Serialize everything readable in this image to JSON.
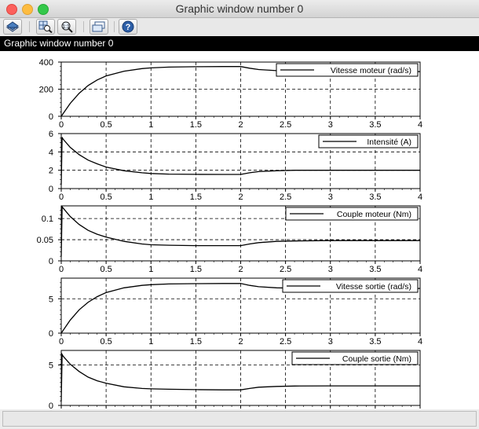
{
  "window": {
    "title": "Graphic window number 0"
  },
  "toolbar": {
    "buttons": [
      {
        "name": "rotate-icon"
      },
      {
        "name": "zoom-icon"
      },
      {
        "name": "unzoom-icon"
      },
      {
        "name": "datatip-icon"
      },
      {
        "name": "help-icon"
      }
    ]
  },
  "header": {
    "label": "Graphic window number 0"
  },
  "chart_data": [
    {
      "type": "line",
      "legend": "Vitesse moteur (rad/s)",
      "legend_position": "top-right",
      "xlim": [
        0,
        4
      ],
      "ylim": [
        0,
        400
      ],
      "xticks": [
        "0",
        "0.5",
        "1",
        "1.5",
        "2",
        "2.5",
        "3",
        "3.5",
        "4"
      ],
      "yticks": [
        0,
        200,
        400
      ],
      "grid": true,
      "x": [
        0,
        0.1,
        0.2,
        0.3,
        0.4,
        0.5,
        0.7,
        0.9,
        1.0,
        1.2,
        1.5,
        1.8,
        2.0,
        2.1,
        2.2,
        2.4,
        2.6,
        3.0,
        3.5,
        4.0
      ],
      "y": [
        0,
        95,
        170,
        227,
        268,
        298,
        333,
        352,
        357,
        363,
        366,
        367,
        367,
        355,
        345,
        337,
        333,
        330,
        330,
        330
      ]
    },
    {
      "type": "line",
      "legend": "Intensité (A)",
      "legend_position": "top-right",
      "xlim": [
        0,
        4
      ],
      "ylim": [
        0,
        6
      ],
      "xticks": [
        "0",
        "0.5",
        "1",
        "1.5",
        "2",
        "2.5",
        "3",
        "3.5",
        "4"
      ],
      "yticks": [
        0,
        2,
        4,
        6
      ],
      "grid": true,
      "x": [
        0,
        0.01,
        0.02,
        0.1,
        0.2,
        0.3,
        0.4,
        0.5,
        0.7,
        0.9,
        1.0,
        1.2,
        1.5,
        1.8,
        2.0,
        2.1,
        2.2,
        2.4,
        2.6,
        3.0,
        3.5,
        4.0
      ],
      "y": [
        0.4,
        5.6,
        5.4,
        4.5,
        3.7,
        3.1,
        2.7,
        2.35,
        1.95,
        1.72,
        1.65,
        1.58,
        1.55,
        1.54,
        1.54,
        1.72,
        1.85,
        1.95,
        2.0,
        2.0,
        2.0,
        2.0
      ]
    },
    {
      "type": "line",
      "legend": "Couple moteur (Nm)",
      "legend_position": "top-right",
      "xlim": [
        0,
        4
      ],
      "ylim": [
        0,
        0.13
      ],
      "xticks": [
        "0",
        "0.5",
        "1",
        "1.5",
        "2",
        "2.5",
        "3",
        "3.5",
        "4"
      ],
      "yticks": [
        0,
        0.05,
        0.1
      ],
      "grid": true,
      "x": [
        0,
        0.01,
        0.02,
        0.1,
        0.2,
        0.3,
        0.4,
        0.5,
        0.7,
        0.9,
        1.0,
        1.2,
        1.5,
        1.8,
        2.0,
        2.1,
        2.2,
        2.4,
        2.6,
        3.0,
        3.5,
        4.0
      ],
      "y": [
        0.01,
        0.128,
        0.125,
        0.105,
        0.086,
        0.072,
        0.063,
        0.056,
        0.046,
        0.04,
        0.038,
        0.037,
        0.036,
        0.036,
        0.036,
        0.04,
        0.043,
        0.046,
        0.047,
        0.048,
        0.048,
        0.048
      ]
    },
    {
      "type": "line",
      "legend": "Vitesse sortie (rad/s)",
      "legend_position": "top-right",
      "xlim": [
        0,
        4
      ],
      "ylim": [
        0,
        8
      ],
      "xticks": [
        "0",
        "0.5",
        "1",
        "1.5",
        "2",
        "2.5",
        "3",
        "3.5",
        "4"
      ],
      "yticks": [
        0,
        5
      ],
      "grid": true,
      "x": [
        0,
        0.1,
        0.2,
        0.3,
        0.4,
        0.5,
        0.7,
        0.9,
        1.0,
        1.2,
        1.5,
        1.8,
        2.0,
        2.1,
        2.2,
        2.4,
        2.6,
        3.0,
        3.5,
        4.0
      ],
      "y": [
        0,
        1.9,
        3.4,
        4.5,
        5.3,
        5.9,
        6.6,
        6.95,
        7.05,
        7.15,
        7.2,
        7.22,
        7.22,
        6.95,
        6.75,
        6.6,
        6.55,
        6.5,
        6.5,
        6.5
      ]
    },
    {
      "type": "line",
      "legend": "Couple sortie (Nm)",
      "legend_position": "top-right",
      "xlim": [
        0,
        4
      ],
      "ylim": [
        0,
        6.8
      ],
      "xticks": [],
      "yticks": [
        0,
        5
      ],
      "grid": true,
      "x": [
        0,
        0.01,
        0.02,
        0.1,
        0.2,
        0.3,
        0.4,
        0.5,
        0.7,
        0.9,
        1.0,
        1.2,
        1.5,
        1.8,
        2.0,
        2.1,
        2.2,
        2.4,
        2.6,
        3.0,
        3.5,
        4.0
      ],
      "y": [
        0.5,
        6.3,
        6.1,
        5.1,
        4.2,
        3.5,
        3.05,
        2.75,
        2.3,
        2.1,
        2.05,
        2.0,
        1.95,
        1.92,
        1.92,
        2.1,
        2.25,
        2.35,
        2.4,
        2.42,
        2.42,
        2.42
      ]
    }
  ]
}
